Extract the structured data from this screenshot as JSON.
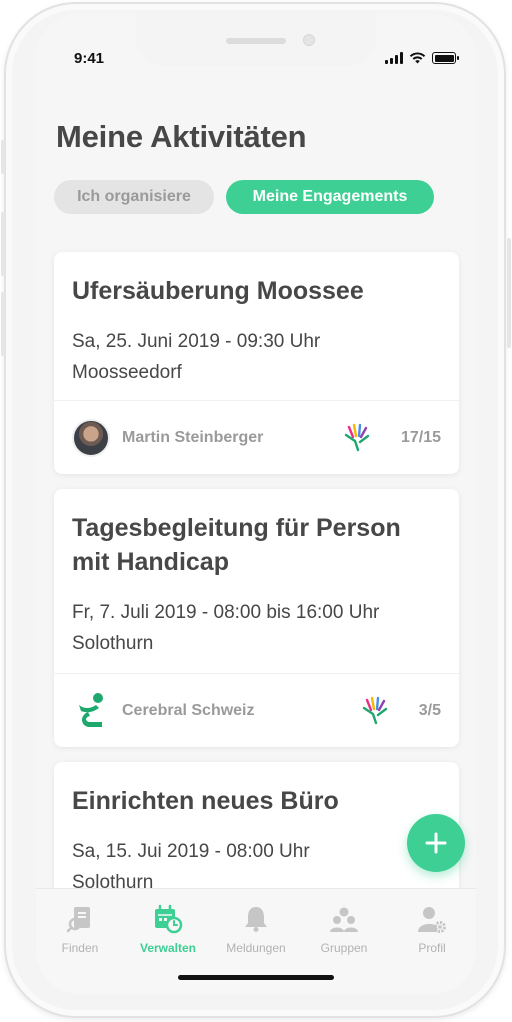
{
  "status_bar": {
    "time": "9:41"
  },
  "header": {
    "title": "Meine Aktivitäten"
  },
  "segments": [
    {
      "label": "Ich organisiere",
      "active": false
    },
    {
      "label": "Meine Engagements",
      "active": true
    }
  ],
  "cards": [
    {
      "title": "Ufersäuberung Moossee",
      "datetime": "Sa, 25. Juni 2019 - 09:30 Uhr",
      "location": "Moosseedorf",
      "organizer": "Martin Steinberger",
      "organizer_icon": "user-avatar",
      "participants": "17/15"
    },
    {
      "title": "Tagesbegleitung für Person mit Handicap",
      "datetime": "Fr, 7. Juli 2019 - 08:00 bis 16:00 Uhr",
      "location": "Solothurn",
      "organizer": "Cerebral Schweiz",
      "organizer_icon": "cerebral-logo",
      "participants": "3/5"
    },
    {
      "title": "Einrichten neues Büro",
      "datetime": "Sa, 15. Jui 2019 - 08:00 Uhr",
      "location": "Solothurn"
    }
  ],
  "fab": {
    "icon": "plus-icon"
  },
  "tabbar": {
    "items": [
      {
        "label": "Finden",
        "icon": "search-document-icon",
        "active": false
      },
      {
        "label": "Verwalten",
        "icon": "calendar-clock-icon",
        "active": true
      },
      {
        "label": "Meldungen",
        "icon": "bell-icon",
        "active": false
      },
      {
        "label": "Gruppen",
        "icon": "group-icon",
        "active": false
      },
      {
        "label": "Profil",
        "icon": "user-settings-icon",
        "active": false
      }
    ]
  },
  "colors": {
    "accent": "#3ecf95",
    "text": "#474747",
    "muted": "#9a9a9a"
  }
}
